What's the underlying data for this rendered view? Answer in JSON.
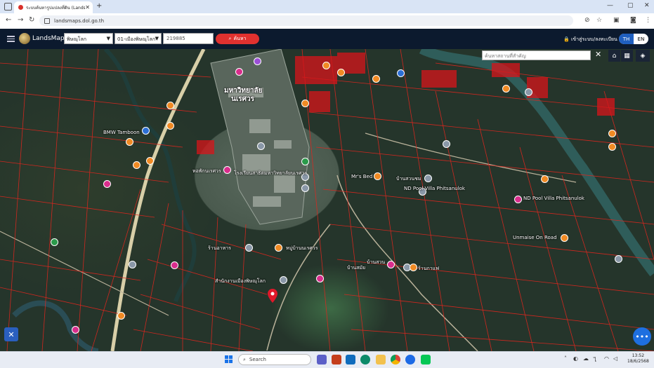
{
  "browser": {
    "tab_title": "ระบบค้นหารูปแปลงที่ดิน (LandsMaps)",
    "tab_close": "✕",
    "new_tab": "+",
    "url": "landsmaps.dol.go.th",
    "window_controls": [
      "—",
      "▢",
      "✕"
    ]
  },
  "app": {
    "brand": "LandsMaps",
    "province_select": "พิษณุโลก",
    "district_select": "01-เมืองพิษณุโลก",
    "parcel_input": "219885",
    "search_button": "ค้นหา",
    "login_link": "เข้าสู่ระบบ/ลงทะเบียน",
    "lang": [
      "TH",
      "EN"
    ],
    "lang_active": "TH"
  },
  "map": {
    "place_search_placeholder": "ค้นหาสถานที่สำคัญ",
    "close": "✕",
    "labels": [
      {
        "text": "มหาวิทยาลัย",
        "style": "big"
      },
      {
        "text": "นเรศวร",
        "style": "big"
      },
      {
        "text": "BMW Tamboon"
      },
      {
        "text": "หอพักนเรศวร"
      },
      {
        "text": "โรงเรียนสาธิตมหาวิทยาลัยนเรศวร"
      },
      {
        "text": "ND Pool Villa Phitsanulok"
      },
      {
        "text": "ND Pool Villa Phitsanulok"
      },
      {
        "text": "Unmaise On Road"
      },
      {
        "text": "หมู่บ้านนเรศวร"
      },
      {
        "text": "ร้านอาหาร"
      },
      {
        "text": "สำนักงานเมืองพิษณุโลก"
      },
      {
        "text": "บ้านสวน"
      },
      {
        "text": "บ้านสมัย"
      },
      {
        "text": "ร้านกาแฟ"
      },
      {
        "text": "Mr's Bed"
      },
      {
        "text": "บ้านสวนชม"
      }
    ]
  },
  "taskbar": {
    "search_placeholder": "Search",
    "time": "13:52",
    "date": "18/6/2568"
  }
}
